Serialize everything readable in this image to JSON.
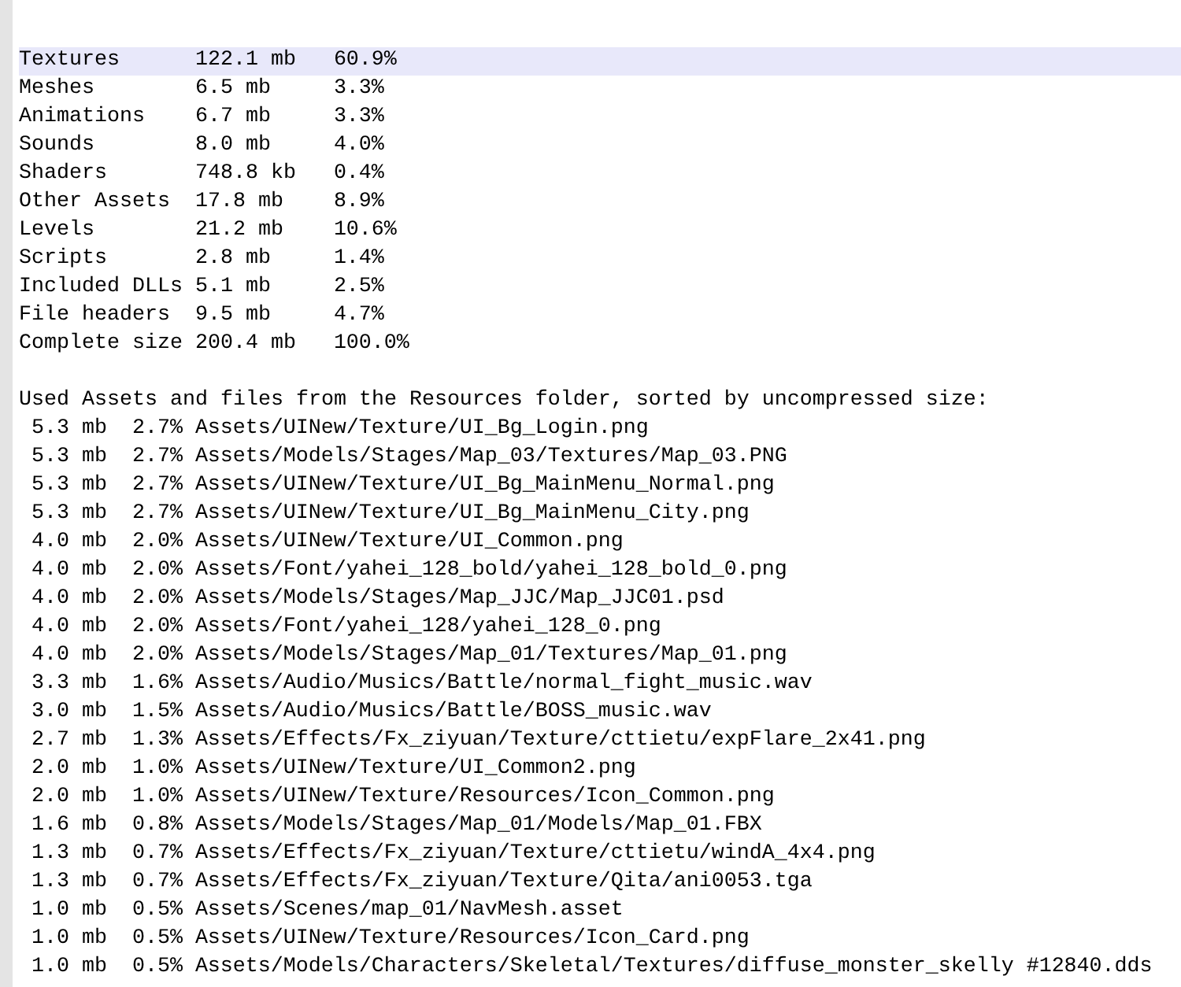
{
  "summary": [
    {
      "name": "Textures",
      "size": "122.1 mb",
      "percent": "60.9%",
      "selected": true
    },
    {
      "name": "Meshes",
      "size": "6.5 mb",
      "percent": "3.3%",
      "selected": false
    },
    {
      "name": "Animations",
      "size": "6.7 mb",
      "percent": "3.3%",
      "selected": false
    },
    {
      "name": "Sounds",
      "size": "8.0 mb",
      "percent": "4.0%",
      "selected": false
    },
    {
      "name": "Shaders",
      "size": "748.8 kb",
      "percent": "0.4%",
      "selected": false
    },
    {
      "name": "Other Assets",
      "size": "17.8 mb",
      "percent": "8.9%",
      "selected": false
    },
    {
      "name": "Levels",
      "size": "21.2 mb",
      "percent": "10.6%",
      "selected": false
    },
    {
      "name": "Scripts",
      "size": "2.8 mb",
      "percent": "1.4%",
      "selected": false
    },
    {
      "name": "Included DLLs",
      "size": "5.1 mb",
      "percent": "2.5%",
      "selected": false
    },
    {
      "name": "File headers",
      "size": "9.5 mb",
      "percent": "4.7%",
      "selected": false
    },
    {
      "name": "Complete size",
      "size": "200.4 mb",
      "percent": "100.0%",
      "selected": false
    }
  ],
  "assets_heading": "Used Assets and files from the Resources folder, sorted by uncompressed size:",
  "assets": [
    {
      "size": "5.3 mb",
      "percent": "2.7%",
      "path": "Assets/UINew/Texture/UI_Bg_Login.png"
    },
    {
      "size": "5.3 mb",
      "percent": "2.7%",
      "path": "Assets/Models/Stages/Map_03/Textures/Map_03.PNG"
    },
    {
      "size": "5.3 mb",
      "percent": "2.7%",
      "path": "Assets/UINew/Texture/UI_Bg_MainMenu_Normal.png"
    },
    {
      "size": "5.3 mb",
      "percent": "2.7%",
      "path": "Assets/UINew/Texture/UI_Bg_MainMenu_City.png"
    },
    {
      "size": "4.0 mb",
      "percent": "2.0%",
      "path": "Assets/UINew/Texture/UI_Common.png"
    },
    {
      "size": "4.0 mb",
      "percent": "2.0%",
      "path": "Assets/Font/yahei_128_bold/yahei_128_bold_0.png"
    },
    {
      "size": "4.0 mb",
      "percent": "2.0%",
      "path": "Assets/Models/Stages/Map_JJC/Map_JJC01.psd"
    },
    {
      "size": "4.0 mb",
      "percent": "2.0%",
      "path": "Assets/Font/yahei_128/yahei_128_0.png"
    },
    {
      "size": "4.0 mb",
      "percent": "2.0%",
      "path": "Assets/Models/Stages/Map_01/Textures/Map_01.png"
    },
    {
      "size": "3.3 mb",
      "percent": "1.6%",
      "path": "Assets/Audio/Musics/Battle/normal_fight_music.wav"
    },
    {
      "size": "3.0 mb",
      "percent": "1.5%",
      "path": "Assets/Audio/Musics/Battle/BOSS_music.wav"
    },
    {
      "size": "2.7 mb",
      "percent": "1.3%",
      "path": "Assets/Effects/Fx_ziyuan/Texture/cttietu/expFlare_2x41.png"
    },
    {
      "size": "2.0 mb",
      "percent": "1.0%",
      "path": "Assets/UINew/Texture/UI_Common2.png"
    },
    {
      "size": "2.0 mb",
      "percent": "1.0%",
      "path": "Assets/UINew/Texture/Resources/Icon_Common.png"
    },
    {
      "size": "1.6 mb",
      "percent": "0.8%",
      "path": "Assets/Models/Stages/Map_01/Models/Map_01.FBX"
    },
    {
      "size": "1.3 mb",
      "percent": "0.7%",
      "path": "Assets/Effects/Fx_ziyuan/Texture/cttietu/windA_4x4.png"
    },
    {
      "size": "1.3 mb",
      "percent": "0.7%",
      "path": "Assets/Effects/Fx_ziyuan/Texture/Qita/ani0053.tga"
    },
    {
      "size": "1.0 mb",
      "percent": "0.5%",
      "path": "Assets/Scenes/map_01/NavMesh.asset"
    },
    {
      "size": "1.0 mb",
      "percent": "0.5%",
      "path": "Assets/UINew/Texture/Resources/Icon_Card.png"
    },
    {
      "size": "1.0 mb",
      "percent": "0.5%",
      "path": "Assets/Models/Characters/Skeletal/Textures/diffuse_monster_skelly #12840.dds"
    }
  ]
}
